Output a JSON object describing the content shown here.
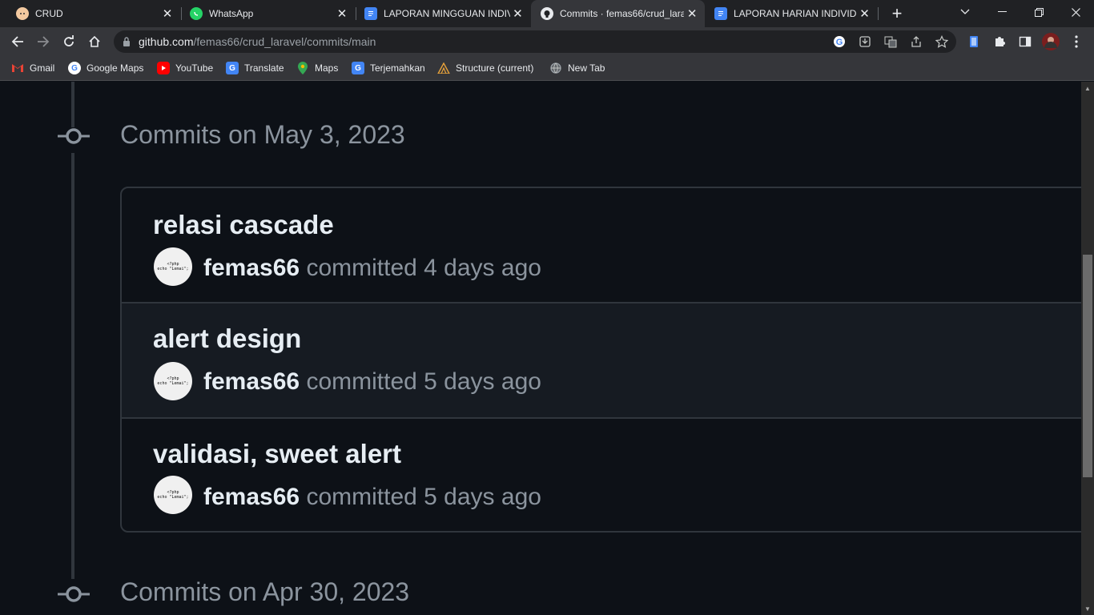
{
  "browser": {
    "tabs": [
      {
        "title": "CRUD",
        "icon": "cat-face-icon",
        "active": false
      },
      {
        "title": "WhatsApp",
        "icon": "whatsapp-icon",
        "active": false
      },
      {
        "title": "LAPORAN MINGGUAN INDIVI",
        "icon": "google-docs-icon",
        "active": false
      },
      {
        "title": "Commits · femas66/crud_lara",
        "icon": "github-icon",
        "active": true
      },
      {
        "title": "LAPORAN HARIAN INDIVIDU",
        "icon": "google-docs-icon",
        "active": false
      }
    ],
    "url_host": "github.com",
    "url_path": "/femas66/crud_laravel/commits/main",
    "bookmarks": [
      {
        "label": "Gmail",
        "icon": "gmail-icon"
      },
      {
        "label": "Google Maps",
        "icon": "google-icon"
      },
      {
        "label": "YouTube",
        "icon": "youtube-icon"
      },
      {
        "label": "Translate",
        "icon": "translate-icon"
      },
      {
        "label": "Maps",
        "icon": "maps-pin-icon"
      },
      {
        "label": "Terjemahkan",
        "icon": "translate-icon"
      },
      {
        "label": "Structure (current)",
        "icon": "structure-icon"
      },
      {
        "label": "New Tab",
        "icon": "globe-icon"
      }
    ]
  },
  "commits_page": {
    "groups": [
      {
        "heading": "Commits on May 3, 2023",
        "commits": [
          {
            "message": "relasi cascade",
            "author": "femas66",
            "verb": "committed",
            "time": "4 days ago"
          },
          {
            "message": "alert design",
            "author": "femas66",
            "verb": "committed",
            "time": "5 days ago"
          },
          {
            "message": "validasi, sweet alert",
            "author": "femas66",
            "verb": "committed",
            "time": "5 days ago"
          }
        ]
      },
      {
        "heading": "Commits on Apr 30, 2023",
        "commits": []
      }
    ],
    "avatar_text": [
      "<?php",
      "echo \"Lemai\";"
    ]
  },
  "colors": {
    "page_bg": "#0d1117",
    "text_primary": "#e6edf3",
    "text_muted": "#8b949e",
    "border": "#30363d"
  }
}
